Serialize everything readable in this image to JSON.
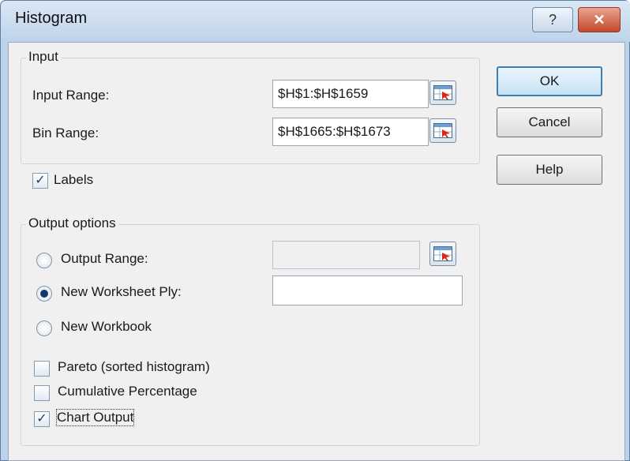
{
  "window": {
    "title": "Histogram",
    "help_glyph": "?",
    "close_glyph": "✕"
  },
  "input_group": {
    "title": "Input",
    "input_range_label": "Input Range:",
    "input_range_value": "$H$1:$H$1659",
    "bin_range_label": "Bin Range:",
    "bin_range_value": "$H$1665:$H$1673"
  },
  "labels_checkbox": {
    "label": "Labels",
    "checked": true
  },
  "output_group": {
    "title": "Output options",
    "output_range_label": "Output Range:",
    "output_range_value": "",
    "new_ply_label": "New Worksheet Ply:",
    "new_ply_value": "",
    "new_workbook_label": "New Workbook",
    "selected": "new_worksheet_ply",
    "pareto_label": "Pareto (sorted histogram)",
    "pareto_checked": false,
    "cumulative_label": "Cumulative Percentage",
    "cumulative_checked": false,
    "chart_output_label": "Chart Output",
    "chart_output_checked": true
  },
  "buttons": {
    "ok": "OK",
    "cancel": "Cancel",
    "help": "Help"
  },
  "icons": {
    "range_select": "range-select-icon",
    "checkmark": "✓"
  },
  "colors": {
    "title_bar": "#bed3ea",
    "close_button": "#c4492c",
    "default_button_border": "#3c7fb1",
    "radio_dot": "#123a72"
  }
}
